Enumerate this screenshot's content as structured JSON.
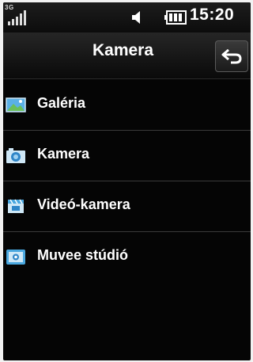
{
  "status_bar": {
    "network_type": "3G",
    "time": "15:20",
    "icons": [
      "signal-icon",
      "speaker-icon",
      "battery-icon"
    ]
  },
  "header": {
    "title": "Kamera",
    "back_icon": "back-arrow-icon"
  },
  "menu": {
    "items": [
      {
        "label": "Galéria",
        "icon": "gallery-icon"
      },
      {
        "label": "Kamera",
        "icon": "camera-icon"
      },
      {
        "label": "Videó-kamera",
        "icon": "video-camera-icon"
      },
      {
        "label": "Muvee stúdió",
        "icon": "muvee-studio-icon"
      }
    ]
  },
  "colors": {
    "background": "#050505",
    "text": "#ffffff",
    "icon_blue": "#4aa8e0"
  }
}
